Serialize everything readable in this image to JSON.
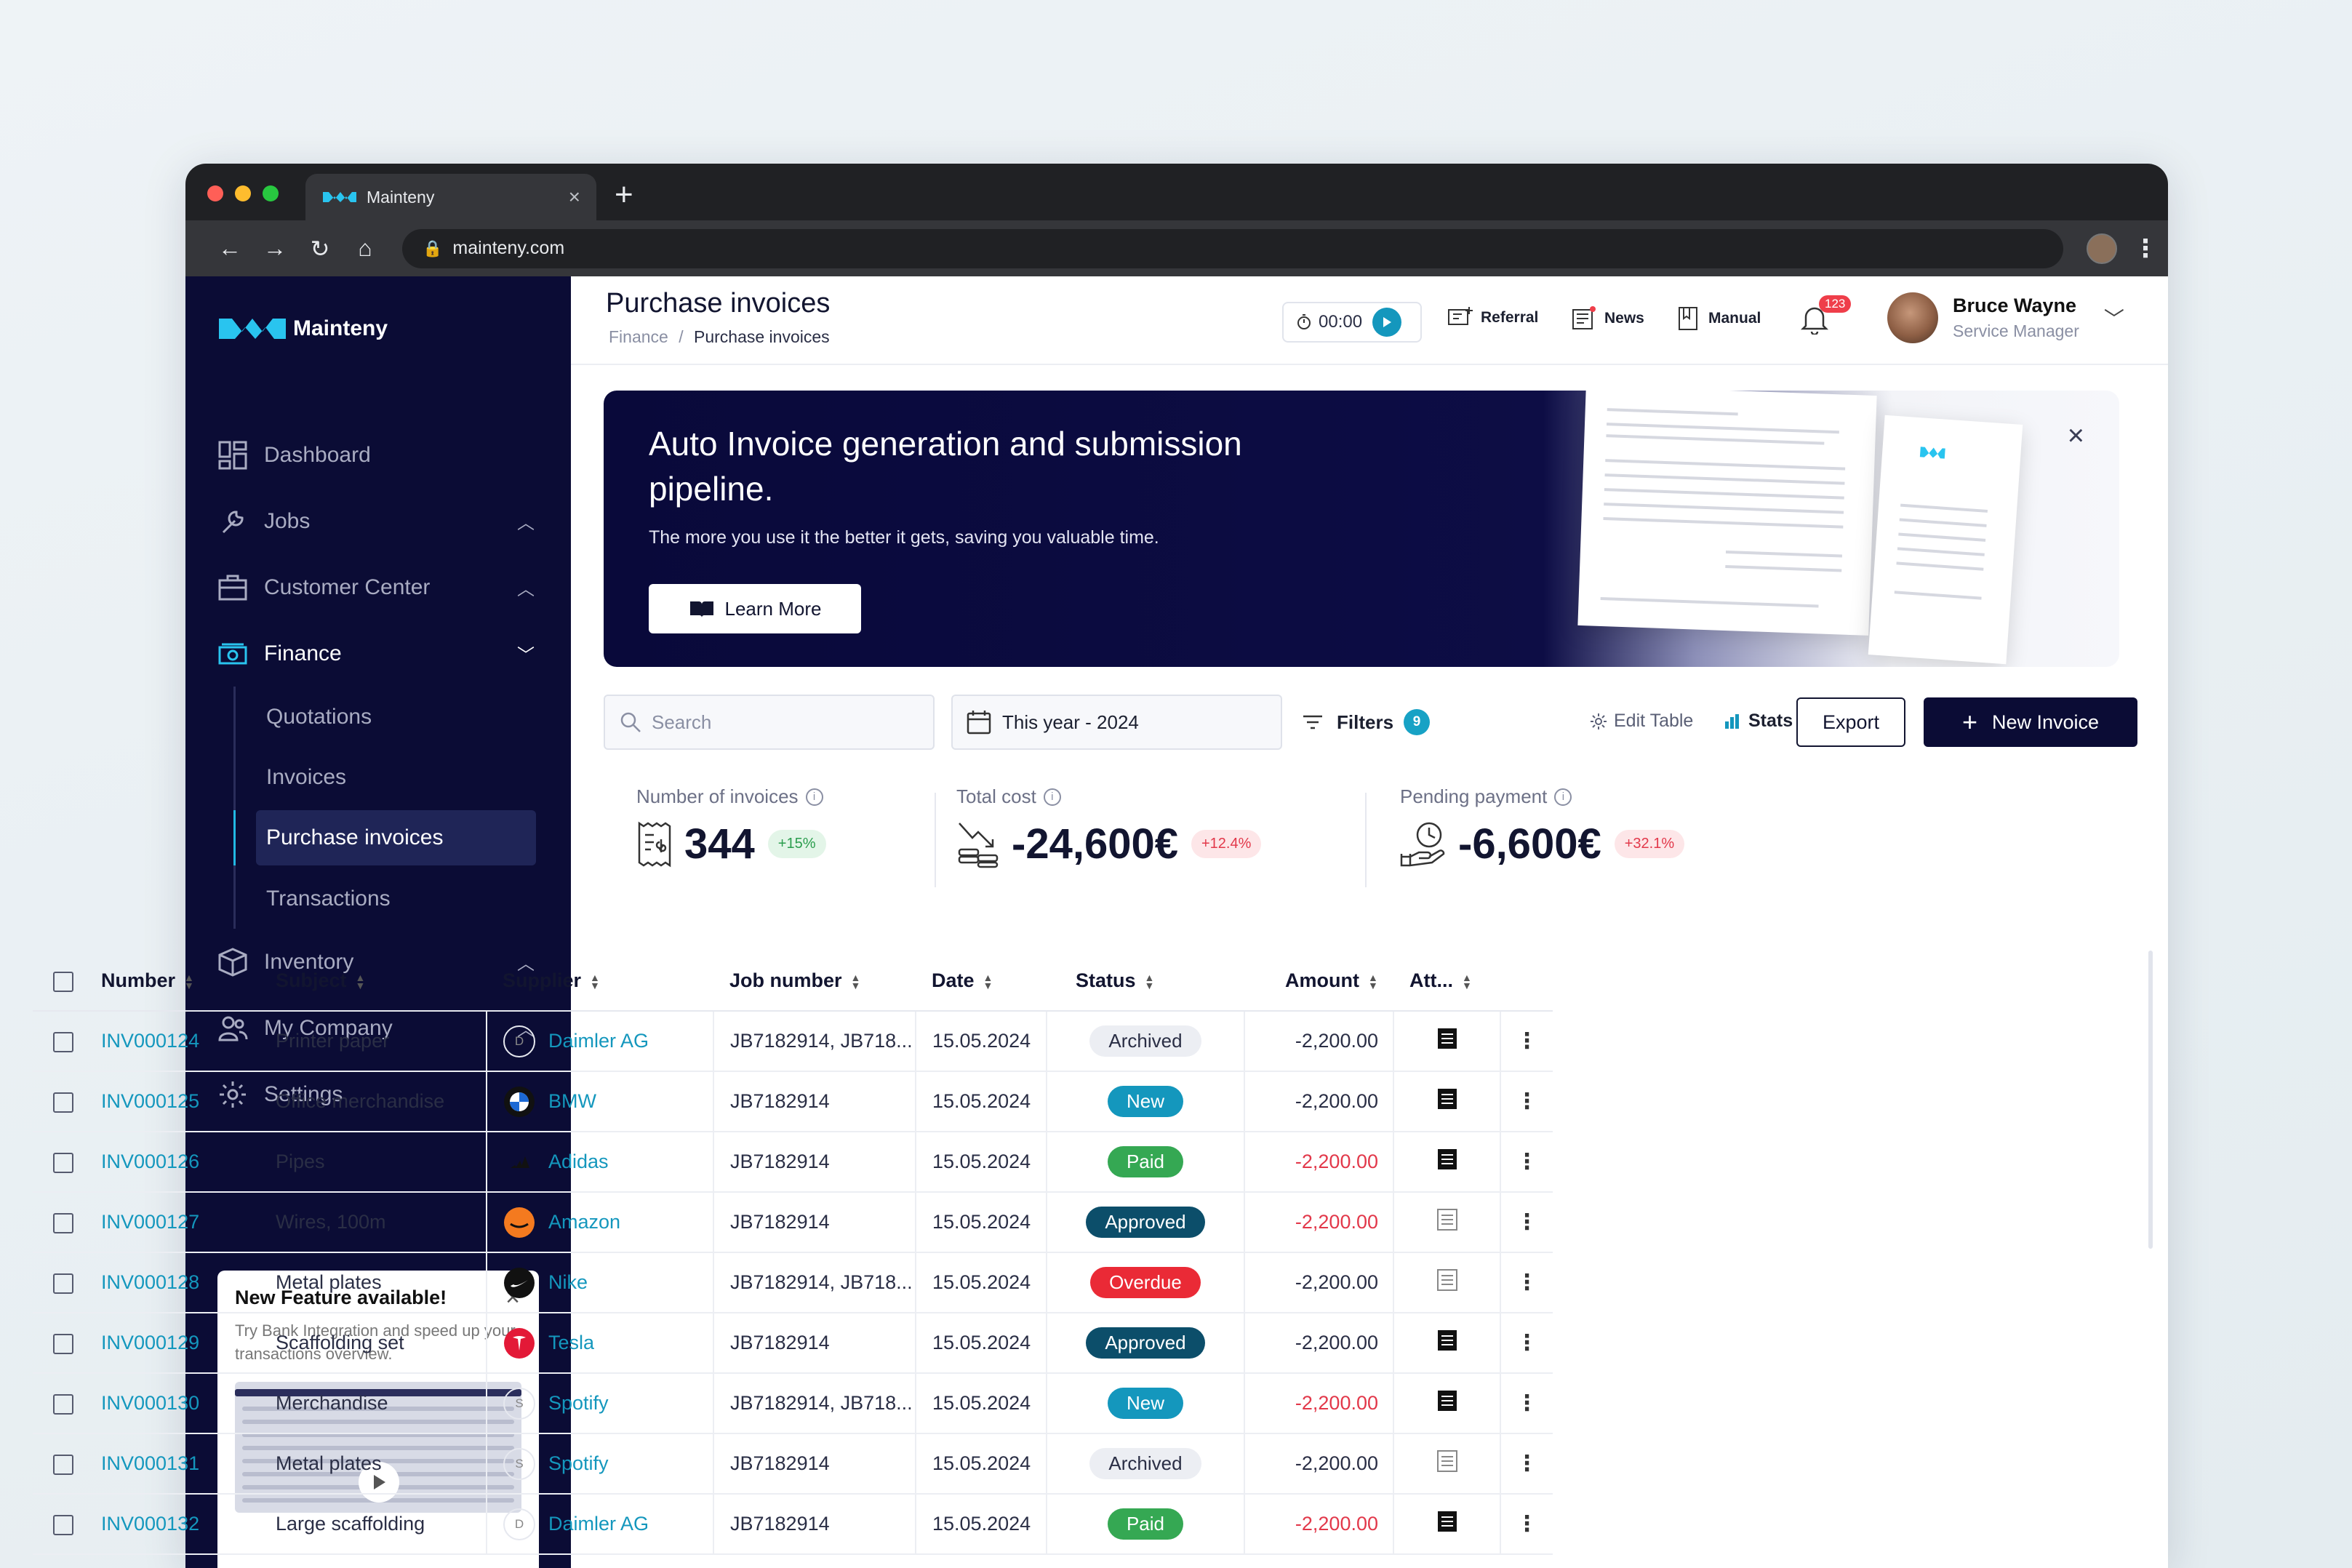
{
  "browser": {
    "tab_title": "Mainteny",
    "url": "mainteny.com"
  },
  "sidebar": {
    "brand": "Mainteny",
    "items": [
      {
        "label": "Dashboard",
        "icon": "dashboard-icon"
      },
      {
        "label": "Jobs",
        "icon": "wrench-icon"
      },
      {
        "label": "Customer Center",
        "icon": "briefcase-icon"
      },
      {
        "label": "Finance",
        "icon": "cash-icon"
      },
      {
        "label": "Inventory",
        "icon": "box-icon"
      },
      {
        "label": "My Company",
        "icon": "people-icon"
      },
      {
        "label": "Settings",
        "icon": "gear-icon"
      }
    ],
    "finance_sub": [
      "Quotations",
      "Invoices",
      "Purchase invoices",
      "Transactions"
    ],
    "feature": {
      "title": "New Feature available!",
      "text": "Try Bank Integration and speed up your transactions overview."
    }
  },
  "header": {
    "title": "Purchase invoices",
    "breadcrumb": [
      "Finance",
      "/",
      "Purchase invoices"
    ],
    "timer": "00:00",
    "links": [
      "Referral",
      "News",
      "Manual"
    ],
    "notifications": "123",
    "user_name": "Bruce Wayne",
    "user_role": "Service Manager"
  },
  "banner": {
    "title": "Auto Invoice generation and submission pipeline.",
    "subtitle": "The more you use it the better it gets, saving you valuable time.",
    "cta": "Learn More"
  },
  "controls": {
    "search_placeholder": "Search",
    "date_range": "This year - 2024",
    "filters_label": "Filters",
    "filters_count": "9",
    "edit_table": "Edit Table",
    "stats": "Stats",
    "export": "Export",
    "new_invoice": "New Invoice"
  },
  "kpis": [
    {
      "label": "Number of invoices",
      "value": "344",
      "change": "+15%",
      "trend": "up"
    },
    {
      "label": "Total cost",
      "value": "-24,600€",
      "change": "+12.4%",
      "trend": "down"
    },
    {
      "label": "Pending payment",
      "value": "-6,600€",
      "change": "+32.1%",
      "trend": "down"
    }
  ],
  "table": {
    "columns": [
      "Number",
      "Subject",
      "Supplier",
      "Job number",
      "Date",
      "Status",
      "Amount",
      "Att..."
    ],
    "rows": [
      {
        "number": "INV000124",
        "subject": "Printer paper",
        "supplier": "Daimler AG",
        "logo": "D",
        "job": "JB7182914, JB718...",
        "date": "15.05.2024",
        "status": "Archived",
        "amount": "-2,200.00",
        "red": false,
        "att": "filled"
      },
      {
        "number": "INV000125",
        "subject": "Office merchandise",
        "supplier": "BMW",
        "logo": "bmw",
        "job": "JB7182914",
        "date": "15.05.2024",
        "status": "New",
        "amount": "-2,200.00",
        "red": false,
        "att": "filled"
      },
      {
        "number": "INV000126",
        "subject": "Pipes",
        "supplier": "Adidas",
        "logo": "adidas",
        "job": "JB7182914",
        "date": "15.05.2024",
        "status": "Paid",
        "amount": "-2,200.00",
        "red": true,
        "att": "filled"
      },
      {
        "number": "INV000127",
        "subject": "Wires, 100m",
        "supplier": "Amazon",
        "logo": "amazon",
        "job": "JB7182914",
        "date": "15.05.2024",
        "status": "Approved",
        "amount": "-2,200.00",
        "red": true,
        "att": "outline"
      },
      {
        "number": "INV000128",
        "subject": "Metal plates",
        "supplier": "Nike",
        "logo": "nike",
        "job": "JB7182914, JB718...",
        "date": "15.05.2024",
        "status": "Overdue",
        "amount": "-2,200.00",
        "red": false,
        "att": "outline"
      },
      {
        "number": "INV000129",
        "subject": "Scaffolding set",
        "supplier": "Tesla",
        "logo": "tesla",
        "job": "JB7182914",
        "date": "15.05.2024",
        "status": "Approved",
        "amount": "-2,200.00",
        "red": false,
        "att": "filled"
      },
      {
        "number": "INV000130",
        "subject": "Merchandise",
        "supplier": "Spotify",
        "logo": "S",
        "job": "JB7182914, JB718...",
        "date": "15.05.2024",
        "status": "New",
        "amount": "-2,200.00",
        "red": true,
        "att": "filled"
      },
      {
        "number": "INV000131",
        "subject": "Metal plates",
        "supplier": "Spotify",
        "logo": "S",
        "job": "JB7182914",
        "date": "15.05.2024",
        "status": "Archived",
        "amount": "-2,200.00",
        "red": false,
        "att": "outline"
      },
      {
        "number": "INV000132",
        "subject": "Large scaffolding",
        "supplier": "Daimler AG",
        "logo": "D",
        "job": "JB7182914",
        "date": "15.05.2024",
        "status": "Paid",
        "amount": "-2,200.00",
        "red": true,
        "att": "filled"
      }
    ]
  },
  "colors": {
    "sidebar_bg": "#0b0c35",
    "accent": "#1497bd",
    "danger": "#e2384a",
    "success": "#35a853"
  }
}
